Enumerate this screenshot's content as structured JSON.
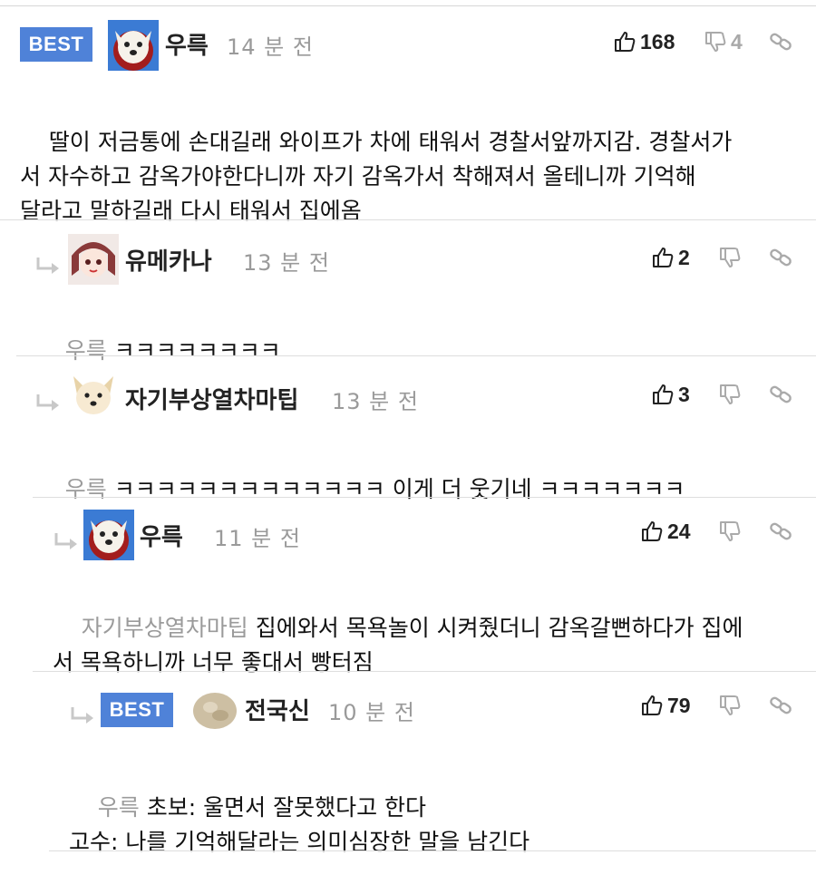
{
  "colors": {
    "best_badge": "#4f82d8",
    "muted": "#9a9a9a",
    "divider": "#dedede"
  },
  "comments": [
    {
      "badge": "BEST",
      "avatar_icon": "dog-avatar-icon",
      "name": "우륵",
      "time": "14 분 전",
      "likes": "168",
      "dislikes": "4",
      "mention": "",
      "text": "딸이 저금통에 손대길래 와이프가 차에 태워서 경찰서앞까지감. 경찰서가\n서 자수하고 감옥가야한다니까 자기 감옥가서 착해져서 올테니까 기억해\n달라고 말하길래 다시 태워서 집에옴"
    },
    {
      "badge": "",
      "avatar_icon": "anime-avatar-icon",
      "name": "유메카나",
      "time": "13 분 전",
      "likes": "2",
      "dislikes": "",
      "mention": "우륵",
      "text": "ㅋㅋㅋㅋㅋㅋㅋㅋ"
    },
    {
      "badge": "",
      "avatar_icon": "shiba-avatar-icon",
      "name": "자기부상열차마팁",
      "time": "13 분 전",
      "likes": "3",
      "dislikes": "",
      "mention": "우륵",
      "text": "ㅋㅋㅋㅋㅋㅋㅋㅋㅋㅋㅋㅋㅋ 이게 더 웃기네 ㅋㅋㅋㅋㅋㅋㅋ"
    },
    {
      "badge": "",
      "avatar_icon": "dog-avatar-icon",
      "name": "우륵",
      "time": "11 분 전",
      "likes": "24",
      "dislikes": "",
      "mention": "자기부상열차마팁",
      "text": "집에와서 목욕놀이 시켜줬더니 감옥갈뻔하다가 집에\n서 목욕하니까 너무 좋대서 빵터짐"
    },
    {
      "badge": "BEST",
      "avatar_icon": "blob-avatar-icon",
      "name": "전국신",
      "time": "10 분 전",
      "likes": "79",
      "dislikes": "",
      "mention": "우륵",
      "text": "초보: 울면서 잘못했다고 한다\n고수: 나를 기억해달라는 의미심장한 말을 남긴다"
    }
  ]
}
